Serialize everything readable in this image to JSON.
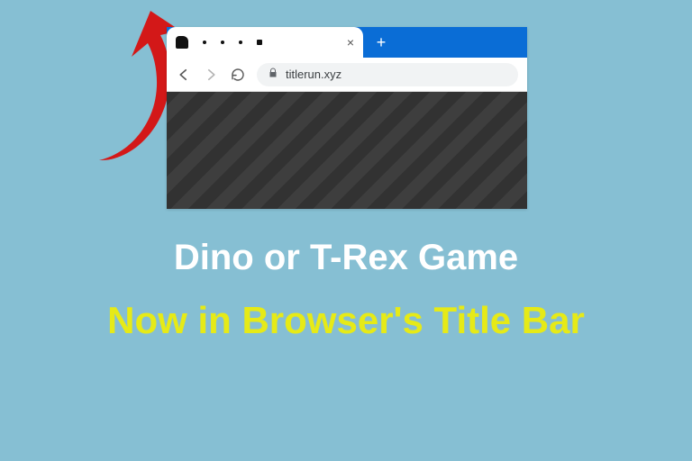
{
  "browser": {
    "url": "titlerun.xyz",
    "close_glyph": "×",
    "new_tab_glyph": "+"
  },
  "headings": {
    "line1": "Dino or T-Rex Game",
    "line2": "Now in Browser's Title Bar"
  }
}
